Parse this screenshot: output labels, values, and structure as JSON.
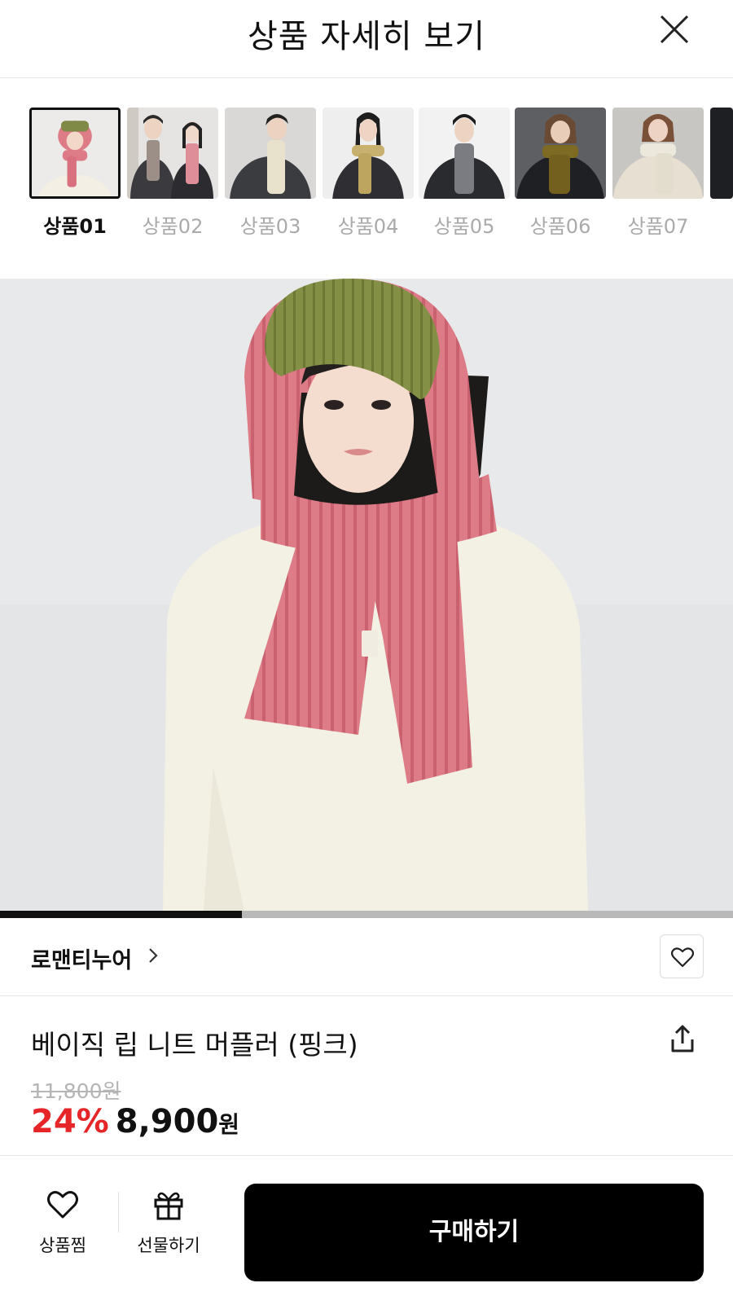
{
  "header": {
    "title": "상품 자세히 보기",
    "close_icon": "close-icon"
  },
  "thumbnails": [
    {
      "label": "상품01",
      "active": true,
      "scarf_color": "#dd7b86",
      "hat_color": "#7f8a47"
    },
    {
      "label": "상품02",
      "active": false,
      "scarf_color": "#9c8f88",
      "hat_color": ""
    },
    {
      "label": "상품03",
      "active": false,
      "scarf_color": "#e8e1cc",
      "hat_color": ""
    },
    {
      "label": "상품04",
      "active": false,
      "scarf_color": "#c8b06f",
      "hat_color": ""
    },
    {
      "label": "상품05",
      "active": false,
      "scarf_color": "#7a7c82",
      "hat_color": ""
    },
    {
      "label": "상품06",
      "active": false,
      "scarf_color": "#7d6a23",
      "hat_color": ""
    },
    {
      "label": "상품07",
      "active": false,
      "scarf_color": "#ece8dc",
      "hat_color": ""
    }
  ],
  "gallery": {
    "progress": 0.33
  },
  "brand": {
    "name": "로맨티누어",
    "chevron_icon": "chevron-right-icon",
    "like_icon": "heart-icon"
  },
  "product": {
    "name": "베이직 립 니트 머플러 (핑크)",
    "share_icon": "share-icon",
    "original_price": "11,800원",
    "discount": "24%",
    "sale_price": "8,900",
    "currency": "원"
  },
  "bottom_bar": {
    "wish_label": "상품찜",
    "wish_icon": "heart-icon",
    "gift_label": "선물하기",
    "gift_icon": "gift-icon",
    "buy_label": "구매하기"
  },
  "colors": {
    "accent_red": "#e52528",
    "primary_button": "#000000",
    "muted_text": "#aaaaaa"
  }
}
